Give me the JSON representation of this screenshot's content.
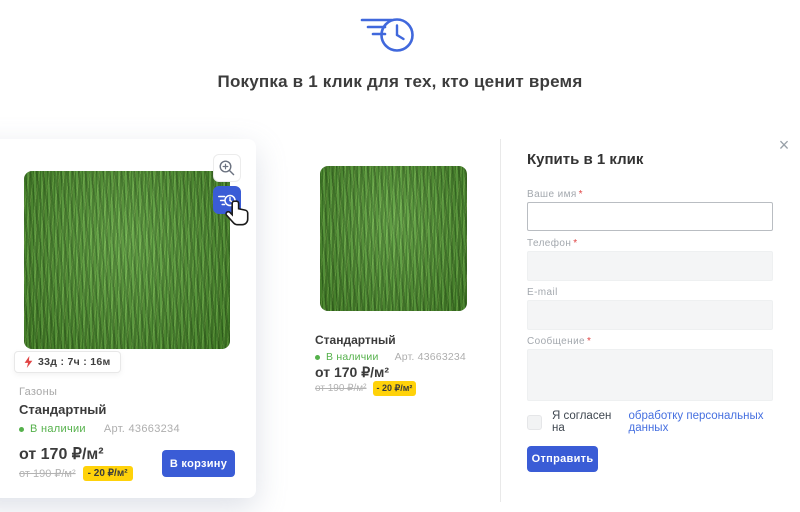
{
  "header": {
    "title": "Покупка в 1 клик для тех, кто ценит время"
  },
  "products": [
    {
      "category": "Газоны",
      "name": "Стандартный",
      "stock": "В наличии",
      "sku": "Арт. 43663234",
      "price": "от 170 ₽/м²",
      "old_price": "от 190 ₽/м²",
      "discount": "- 20 ₽/м²",
      "timer": "33д : 7ч : 16м",
      "cart_button": "В корзину"
    },
    {
      "name": "Стандартный",
      "stock": "В наличии",
      "sku": "Арт. 43663234",
      "price": "от 170 ₽/м²",
      "old_price": "от 190 ₽/м²",
      "discount": "- 20 ₽/м²"
    }
  ],
  "form": {
    "title": "Купить в 1 клик",
    "close_glyph": "×",
    "required_mark": "*",
    "fields": [
      {
        "label": "Ваше имя",
        "required": true
      },
      {
        "label": "Телефон",
        "required": true
      },
      {
        "label": "E-mail",
        "required": false
      },
      {
        "label": "Сообщение",
        "required": true
      }
    ],
    "consent_text": "Я согласен на",
    "consent_link": "обработку персональных данных",
    "submit_label": "Отправить"
  },
  "colors": {
    "accent": "#3a5cd6",
    "link": "#4670e0",
    "green": "#55b14b",
    "yellow": "#ffd20a",
    "danger": "#e04444"
  }
}
